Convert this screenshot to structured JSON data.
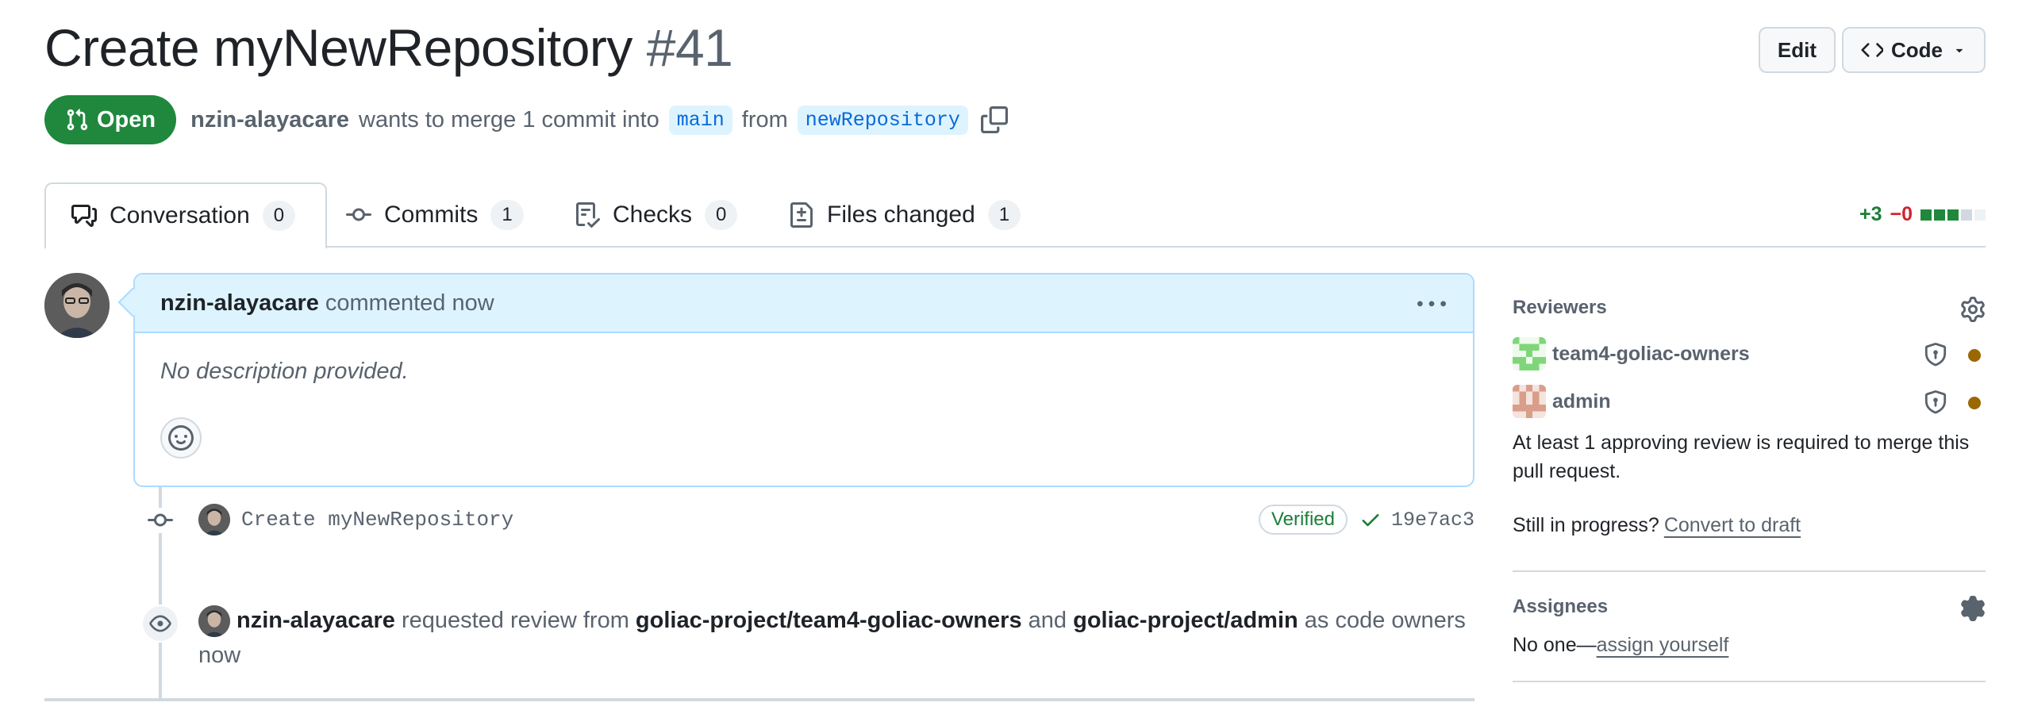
{
  "header": {
    "title": "Create myNewRepository",
    "number": "#41",
    "edit_label": "Edit",
    "code_label": "Code"
  },
  "meta": {
    "state": "Open",
    "author": "nzin-alayacare",
    "merge_text": "wants to merge 1 commit into",
    "base_branch": "main",
    "from_text": "from",
    "head_branch": "newRepository"
  },
  "tabs": [
    {
      "label": "Conversation",
      "count": "0"
    },
    {
      "label": "Commits",
      "count": "1"
    },
    {
      "label": "Checks",
      "count": "0"
    },
    {
      "label": "Files changed",
      "count": "1"
    }
  ],
  "diffstat": {
    "additions": "+3",
    "deletions": "−0"
  },
  "comment": {
    "author": "nzin-alayacare",
    "action": "commented now",
    "body": "No description provided."
  },
  "commit": {
    "message": "Create myNewRepository",
    "verified": "Verified",
    "sha": "19e7ac3"
  },
  "review_request": {
    "actor": "nzin-alayacare",
    "text1": "requested review from",
    "team1": "goliac-project/team4-goliac-owners",
    "and": "and",
    "team2": "goliac-project/admin",
    "text2": "as code owners",
    "time": "now"
  },
  "sidebar": {
    "reviewers_title": "Reviewers",
    "reviewers": [
      {
        "name": "team4-goliac-owners"
      },
      {
        "name": "admin"
      }
    ],
    "approval_note": "At least 1 approving review is required to merge this pull request.",
    "draft_prefix": "Still in progress?",
    "draft_link": "Convert to draft",
    "assignees_title": "Assignees",
    "assignees_none": "No one—",
    "assign_link": "assign yourself"
  },
  "colors": {
    "open_green": "#1f883d",
    "branch_bg": "#ddf4ff",
    "link_blue": "#0969da",
    "pending_dot": "#9a6700"
  }
}
